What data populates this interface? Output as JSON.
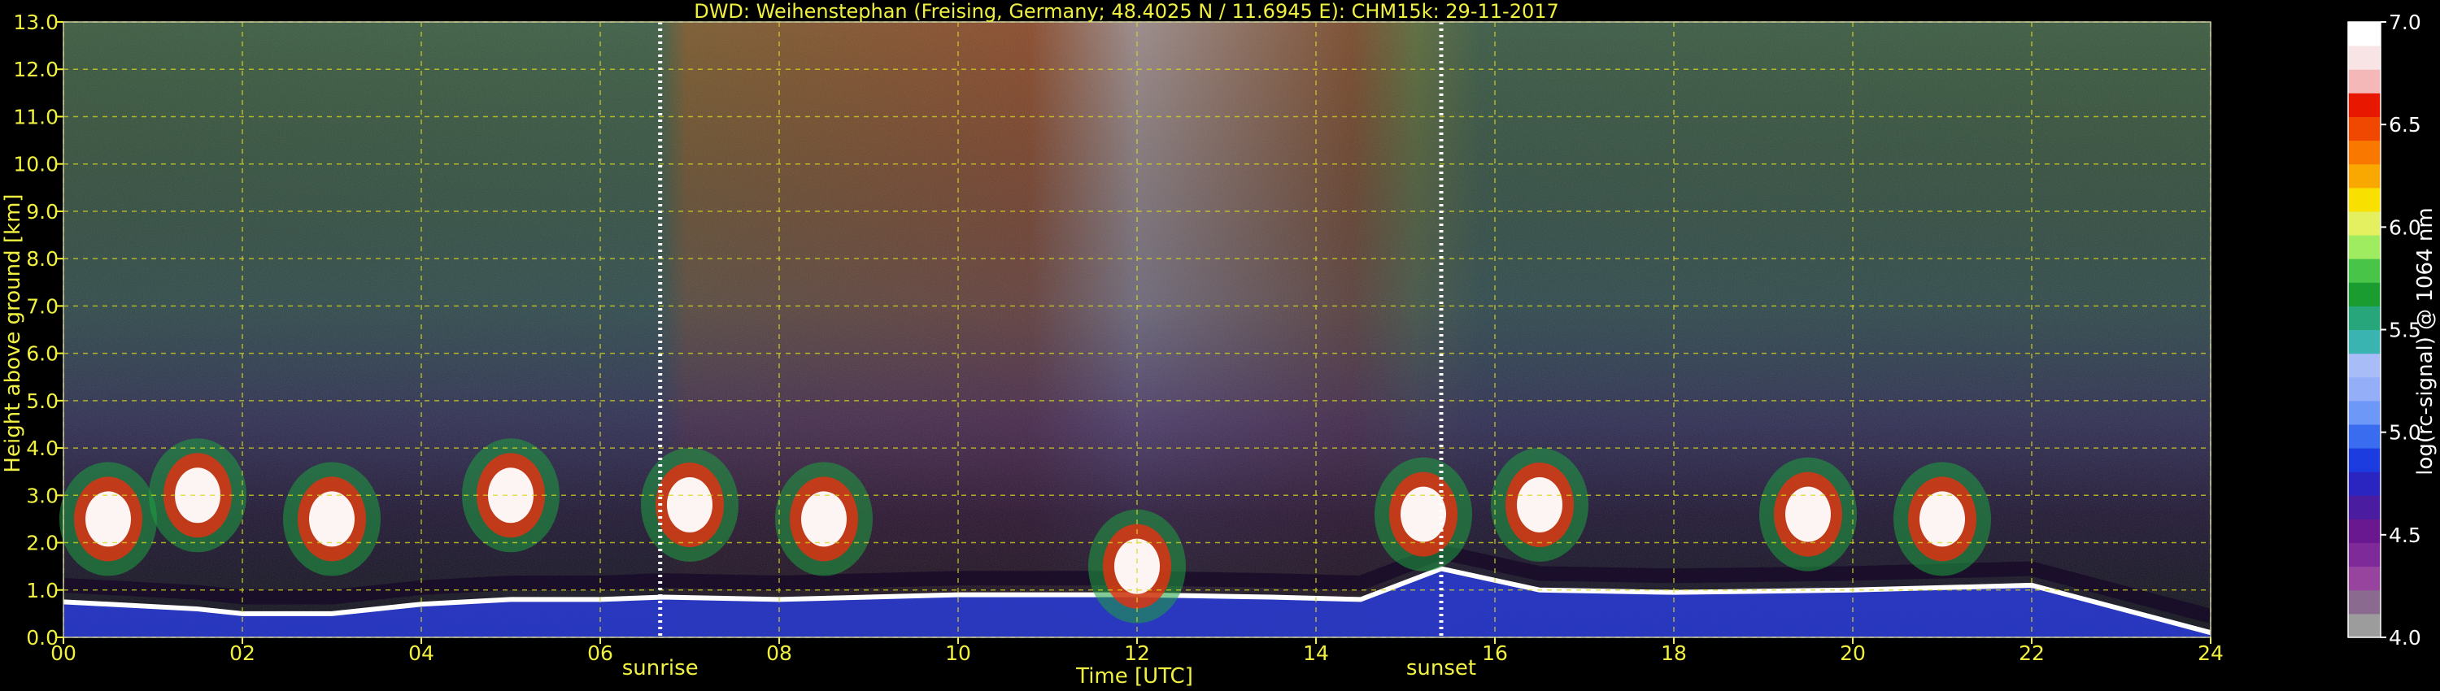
{
  "chart_data": {
    "type": "heatmap",
    "title": "DWD: Weihenstephan (Freising, Germany; 48.4025 N / 11.6945 E):    CHM15k: 29-11-2017",
    "xlabel": "Time [UTC]",
    "ylabel": "Height above ground [km]",
    "xlim": [
      0,
      24
    ],
    "ylim": [
      0,
      13
    ],
    "x_ticks": [
      "00",
      "02",
      "04",
      "06",
      "08",
      "10",
      "12",
      "14",
      "16",
      "18",
      "20",
      "22",
      "24"
    ],
    "y_ticks": [
      "0.0",
      "1.0",
      "2.0",
      "3.0",
      "4.0",
      "5.0",
      "6.0",
      "7.0",
      "8.0",
      "9.0",
      "10.0",
      "11.0",
      "12.0",
      "13.0"
    ],
    "grid": true,
    "markers": [
      {
        "label": "sunrise",
        "time": 6.67
      },
      {
        "label": "sunset",
        "time": 15.4
      }
    ],
    "colorbar": {
      "label": "log(rc-signal) @ 1064 nm",
      "range": [
        4.0,
        7.0
      ],
      "ticks": [
        "4.0",
        "4.5",
        "5.0",
        "5.5",
        "6.0",
        "6.5",
        "7.0"
      ],
      "colors": [
        "#9c9c9c",
        "#8a6a8e",
        "#96449e",
        "#7e2a98",
        "#6a1890",
        "#4a1ca0",
        "#2a24c0",
        "#1c3ce0",
        "#3a6cf0",
        "#6e98f8",
        "#94aef8",
        "#a8bcf8",
        "#3ab4b0",
        "#26a67a",
        "#1a9c30",
        "#48c448",
        "#a0ec60",
        "#e4f060",
        "#f8e000",
        "#f8a800",
        "#f87800",
        "#f04800",
        "#e81800",
        "#f4b8b8",
        "#f8e4e4",
        "#ffffff"
      ]
    },
    "series": [
      {
        "layer": "boundary layer top",
        "time": [
          0,
          1.5,
          2,
          3,
          4,
          5,
          6,
          6.7,
          8,
          10,
          12,
          13.5,
          14.5,
          15.4,
          16.5,
          18,
          20,
          22,
          24
        ],
        "height_km": [
          0.75,
          0.6,
          0.5,
          0.5,
          0.7,
          0.8,
          0.8,
          0.85,
          0.8,
          0.9,
          0.9,
          0.85,
          0.8,
          1.45,
          1.0,
          0.95,
          1.0,
          1.1,
          0.1
        ]
      },
      {
        "layer": "cloud layer",
        "time": [
          0.5,
          1.5,
          3,
          5,
          7.0,
          8.5,
          12,
          15.2,
          16.5,
          19.5,
          21
        ],
        "height_km": [
          2.5,
          3.0,
          2.5,
          3.0,
          2.8,
          2.5,
          1.5,
          2.6,
          2.8,
          2.6,
          2.5
        ]
      }
    ]
  }
}
